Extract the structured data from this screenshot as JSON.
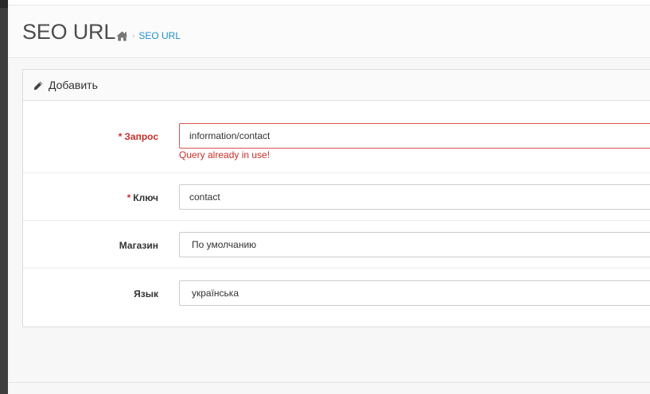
{
  "header": {
    "title": "SEO URL",
    "breadcrumb": [
      {
        "icon": "home-icon"
      },
      {
        "label": "SEO URL"
      }
    ]
  },
  "panel": {
    "heading": "Добавить",
    "heading_icon": "pencil-icon"
  },
  "form": {
    "query": {
      "label": "Запрос",
      "required": true,
      "value": "information/contact",
      "error": "Query already in use!"
    },
    "keyword": {
      "label": "Ключ",
      "required": true,
      "value": "contact"
    },
    "store": {
      "label": "Магазин",
      "selected": "По умолчанию"
    },
    "language": {
      "label": "Язык",
      "selected": "українська"
    }
  },
  "colors": {
    "accent_link": "#1e91cf",
    "error": "#c72f29",
    "sidebar": "#3d3d3d"
  }
}
